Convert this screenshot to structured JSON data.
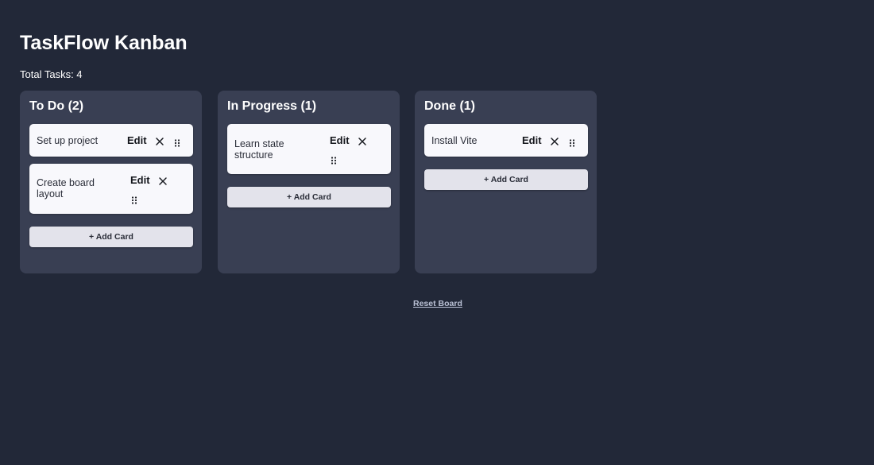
{
  "app": {
    "title": "TaskFlow Kanban",
    "total_tasks": "Total Tasks: 4"
  },
  "columns": [
    {
      "title": "To Do (2)",
      "cards": [
        {
          "text": "Set up project",
          "edit_label": "Edit"
        },
        {
          "text": "Create board layout",
          "edit_label": "Edit"
        }
      ],
      "add_label": "+ Add Card"
    },
    {
      "title": "In Progress (1)",
      "cards": [
        {
          "text": "Learn state structure",
          "edit_label": "Edit"
        }
      ],
      "add_label": "+ Add Card"
    },
    {
      "title": "Done (1)",
      "cards": [
        {
          "text": "Install Vite",
          "edit_label": "Edit"
        }
      ],
      "add_label": "+ Add Card"
    }
  ],
  "footer": {
    "reset_label": "Reset Board"
  },
  "icons": {
    "delete": "close-icon",
    "drag": "drag-handle-icon"
  },
  "colors": {
    "background": "#222838",
    "column": "#393f53",
    "card": "#f8f8fc",
    "add_button": "#e3e3eb",
    "reset_link": "#b9c0d4"
  }
}
